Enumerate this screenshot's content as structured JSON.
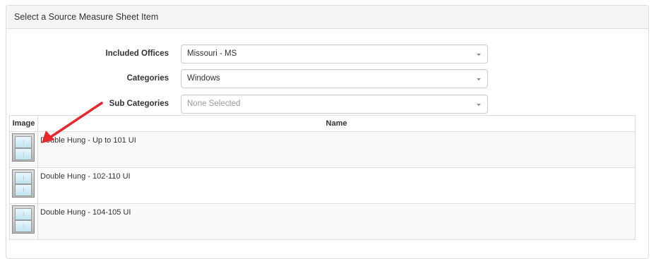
{
  "panel": {
    "title": "Select a Source Measure Sheet Item"
  },
  "form": {
    "included_offices": {
      "label": "Included Offices",
      "value": "Missouri - MS"
    },
    "categories": {
      "label": "Categories",
      "value": "Windows"
    },
    "sub_categories": {
      "label": "Sub Categories",
      "placeholder": "None Selected"
    }
  },
  "table": {
    "headers": {
      "image": "Image",
      "name": "Name"
    },
    "rows": [
      {
        "name": "Double Hung - Up to 101 UI",
        "image_icon": "window-icon"
      },
      {
        "name": "Double Hung - 102-110 UI",
        "image_icon": "window-icon"
      },
      {
        "name": "Double Hung - 104-105 UI",
        "image_icon": "window-icon"
      }
    ]
  },
  "annotation": {
    "arrow_color": "#e8262b"
  }
}
